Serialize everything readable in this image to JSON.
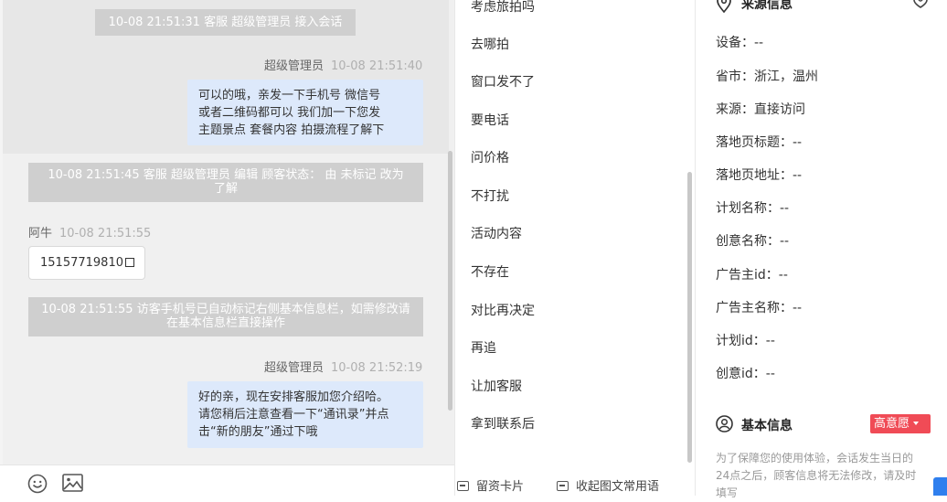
{
  "chat": {
    "system_join": "10-08 21:51:31 客服 超级管理员 接入会话",
    "msg1": {
      "sender": "超级管理员",
      "time": "10-08 21:51:40",
      "lines": [
        "可以的哦，亲发一下手机号 微信号",
        "或者二维码都可以 我们加一下您发",
        "主题景点 套餐内容 拍摄流程了解下"
      ]
    },
    "system_edit": "10-08 21:51:45 客服 超级管理员 编辑 顾客状态： 由 未标记 改为 了解",
    "msg2": {
      "sender": "阿牛",
      "time": "10-08 21:51:55",
      "phone": "15157719810"
    },
    "system_phone": "10-08 21:51:55 访客手机号已自动标记右侧基本信息栏，如需修改请在基本信息栏直接操作",
    "msg3": {
      "sender": "超级管理员",
      "time": "10-08 21:52:19",
      "lines": [
        "好的亲，现在安排客服加您介绍哈。",
        "请您稍后注意查看一下“通讯录”并点",
        "击“新的朋友”通过下哦"
      ]
    },
    "toolbar": {
      "emoji_icon": "emoji-icon",
      "image_icon": "image-icon"
    }
  },
  "phrases": {
    "items": [
      "考虑旅拍吗",
      "去哪拍",
      "窗口发不了",
      "要电话",
      "问价格",
      "不打扰",
      "活动内容",
      "不存在",
      "对比再决定",
      "再追",
      "让加客服",
      "拿到联系后"
    ],
    "tool_card": "留资卡片",
    "tool_collect": "收起图文常用语"
  },
  "info": {
    "source_title": "来源信息",
    "source_rows": [
      {
        "label": "设备：",
        "value": "--"
      },
      {
        "label": "省市：",
        "value": "浙江，温州"
      },
      {
        "label": "来源：",
        "value": "直接访问"
      },
      {
        "label": "落地页标题：",
        "value": "--"
      },
      {
        "label": "落地页地址：",
        "value": "--"
      },
      {
        "label": "计划名称：",
        "value": "--"
      },
      {
        "label": "创意名称：",
        "value": "--"
      },
      {
        "label": "广告主id：",
        "value": "--"
      },
      {
        "label": "广告主名称：",
        "value": "--"
      },
      {
        "label": "计划id：",
        "value": "--"
      },
      {
        "label": "创意id：",
        "value": "--"
      }
    ],
    "basic_title": "基本信息",
    "intent_tag": "高意愿",
    "notice": "为了保障您的使用体验，会话发生当日的24点之后，顾客信息将无法修改，请及时填写",
    "accent_red": "#f04b56",
    "accent_blue": "#2f7fee"
  }
}
